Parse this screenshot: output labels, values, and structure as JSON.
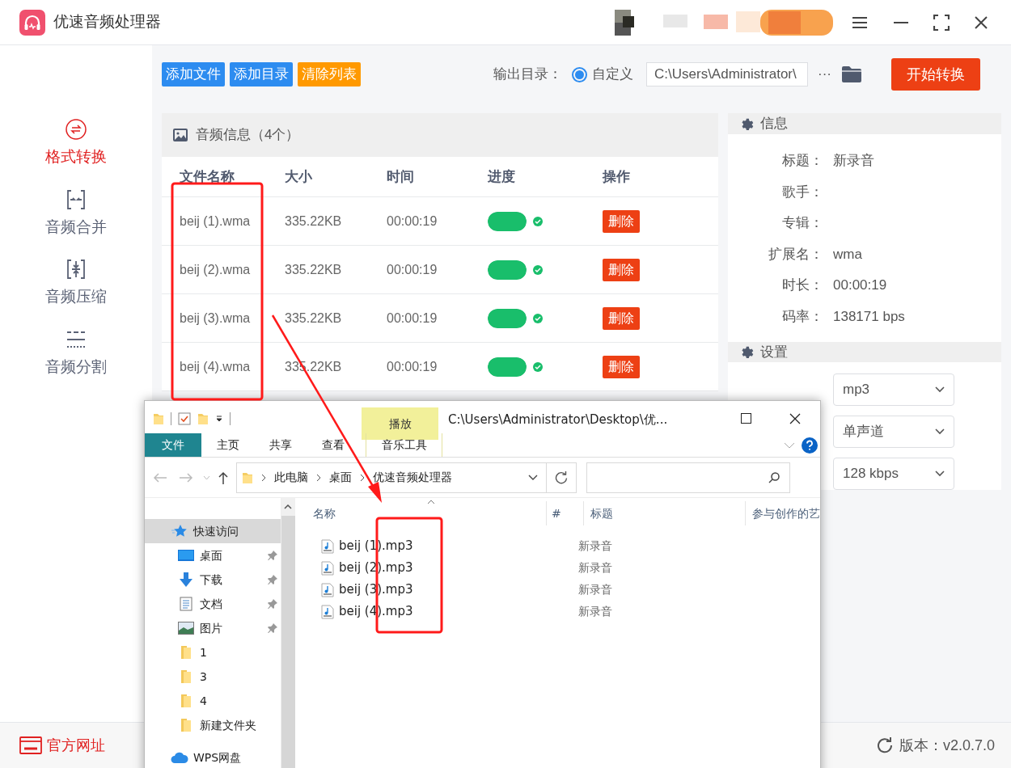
{
  "app": {
    "title": "优速音频处理器"
  },
  "sidebar": {
    "items": [
      {
        "label": "格式转换",
        "kind": "convert",
        "selected": true
      },
      {
        "label": "音频合并",
        "kind": "merge",
        "selected": false
      },
      {
        "label": "音频压缩",
        "kind": "compress",
        "selected": false
      },
      {
        "label": "音频分割",
        "kind": "split",
        "selected": false
      }
    ]
  },
  "toolbar": {
    "buttons": [
      {
        "label": "添加文件",
        "color": "#2d8cf0"
      },
      {
        "label": "添加目录",
        "color": "#2d8cf0"
      },
      {
        "label": "清除列表",
        "color": "#ff9900"
      }
    ],
    "output_label": "输出目录：",
    "radio": {
      "label": "自定义",
      "checked": true
    },
    "path": "C:\\Users\\Administrator\\",
    "more": "···",
    "start": "开始转换"
  },
  "audio_panel": {
    "title": "音频信息（4个）",
    "columns": [
      "文件名称",
      "大小",
      "时间",
      "进度",
      "操作"
    ],
    "rows": [
      {
        "name": "beij (1).wma",
        "size": "335.22KB",
        "time": "00:00:19",
        "level": 1,
        "done": true,
        "action": "删除"
      },
      {
        "name": "beij (2).wma",
        "size": "335.22KB",
        "time": "00:00:19",
        "level": 1,
        "done": true,
        "action": "删除"
      },
      {
        "name": "beij (3).wma",
        "size": "335.22KB",
        "time": "00:00:19",
        "level": 1,
        "done": true,
        "action": "删除"
      },
      {
        "name": "beij (4).wma",
        "size": "335.22KB",
        "time": "00:00:19",
        "level": 1,
        "done": true,
        "action": "删除"
      }
    ]
  },
  "info_panel": {
    "title": "信息",
    "fields": [
      {
        "label": "标题：",
        "value": "新录音"
      },
      {
        "label": "歌手："
      },
      {
        "label": "专辑："
      },
      {
        "label": "扩展名：",
        "value": "wma"
      },
      {
        "label": "时长：",
        "value": "00:00:19"
      },
      {
        "label": "码率：",
        "value": "138171 bps"
      }
    ]
  },
  "settings_panel": {
    "title": "设置",
    "selects": [
      "mp3",
      "单声道",
      "128 kbps"
    ]
  },
  "footer": {
    "website": "官方网址",
    "version": "版本：v2.0.7.0"
  },
  "explorer": {
    "context_tab": "播放",
    "title": "C:\\Users\\Administrator\\Desktop\\优...",
    "ribbon_tabs": [
      {
        "label": "文件",
        "selected": true
      },
      {
        "label": "主页",
        "selected": false
      },
      {
        "label": "共享",
        "selected": false
      },
      {
        "label": "查看",
        "selected": false
      },
      {
        "label": "音乐工具",
        "selected": false
      }
    ],
    "breadcrumb": [
      "此电脑",
      "桌面",
      "优速音频处理器"
    ],
    "nav": [
      {
        "label": "快速访问",
        "kind": "star",
        "pinned": false,
        "selected": true
      },
      {
        "label": "桌面",
        "kind": "desktop",
        "pinned": true,
        "selected": false
      },
      {
        "label": "下载",
        "kind": "download",
        "pinned": true,
        "selected": false
      },
      {
        "label": "文档",
        "kind": "document",
        "pinned": true,
        "selected": false
      },
      {
        "label": "图片",
        "kind": "image",
        "pinned": true,
        "selected": false
      },
      {
        "label": "1",
        "kind": "folder",
        "pinned": false,
        "selected": false
      },
      {
        "label": "3",
        "kind": "folder",
        "pinned": false,
        "selected": false
      },
      {
        "label": "4",
        "kind": "folder",
        "pinned": false,
        "selected": false
      },
      {
        "label": "新建文件夹",
        "kind": "folder",
        "pinned": false,
        "selected": false
      },
      {
        "label": "WPS网盘",
        "kind": "cloud",
        "pinned": false,
        "selected": false
      }
    ],
    "columns": [
      "名称",
      "#",
      "标题",
      "参与创作的艺"
    ],
    "files": [
      {
        "name": "beij (1).mp3",
        "title": "新录音"
      },
      {
        "name": "beij (2).mp3",
        "title": "新录音"
      },
      {
        "name": "beij (3).mp3",
        "title": "新录音"
      },
      {
        "name": "beij (4).mp3",
        "title": "新录音"
      }
    ]
  }
}
